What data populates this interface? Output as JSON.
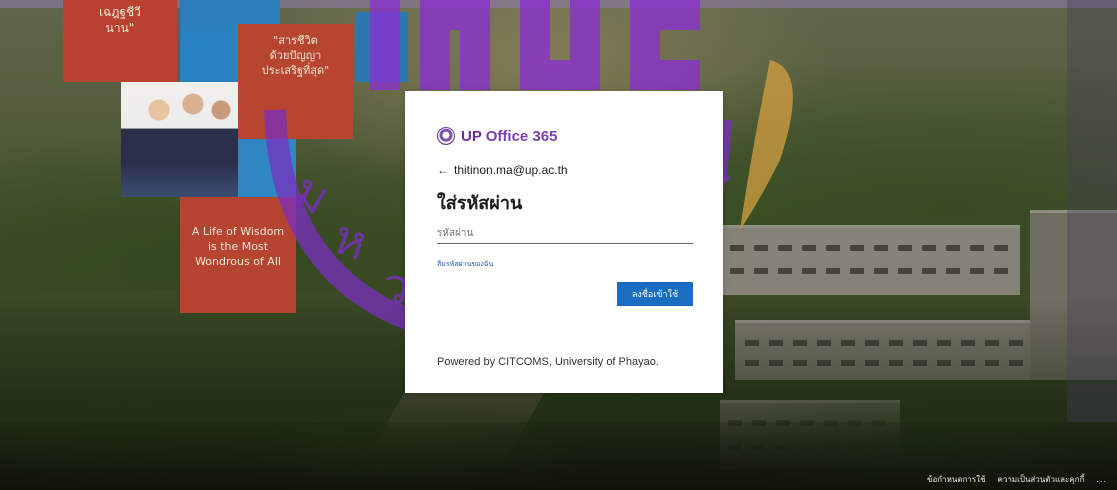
{
  "background": {
    "promo_tiles": {
      "tile1_text": "เฉฎฐชีวี\nนาน\"",
      "tile2_text": "\"สารชีวิต\nด้วยปัญญา\nประเสริฐที่สุด\"",
      "tile3_text": "A Life of Wisdom\nis the Most\nWondrous of All"
    }
  },
  "card": {
    "brand": {
      "up": "UP",
      "office": "Office 365"
    },
    "back": {
      "arrow": "←",
      "email": "thitinon.ma@up.ac.th"
    },
    "title": "ใส่รหัสผ่าน",
    "password": {
      "value": "",
      "placeholder": "รหัสผ่าน"
    },
    "forgot_link": "ลืมรหัสผ่านของฉัน",
    "signin_button": "ลงชื่อเข้าใช้",
    "powered_by": "Powered by CITCOMS, University of Phayao."
  },
  "footer": {
    "terms": "ข้อกำหนดการใช้",
    "privacy": "ความเป็นส่วนตัวและคุกกี้",
    "more": "..."
  },
  "colors": {
    "brand_purple": "#6a2fa0",
    "button_blue": "#1b6dc1",
    "tile_red": "#b8412f",
    "tile_blue": "#2a82c0",
    "watermark_purple": "#8a2fd0"
  },
  "icons": {
    "brand": "up-logo-icon",
    "back": "back-arrow-icon",
    "watermark": "university-seal-watermark"
  }
}
